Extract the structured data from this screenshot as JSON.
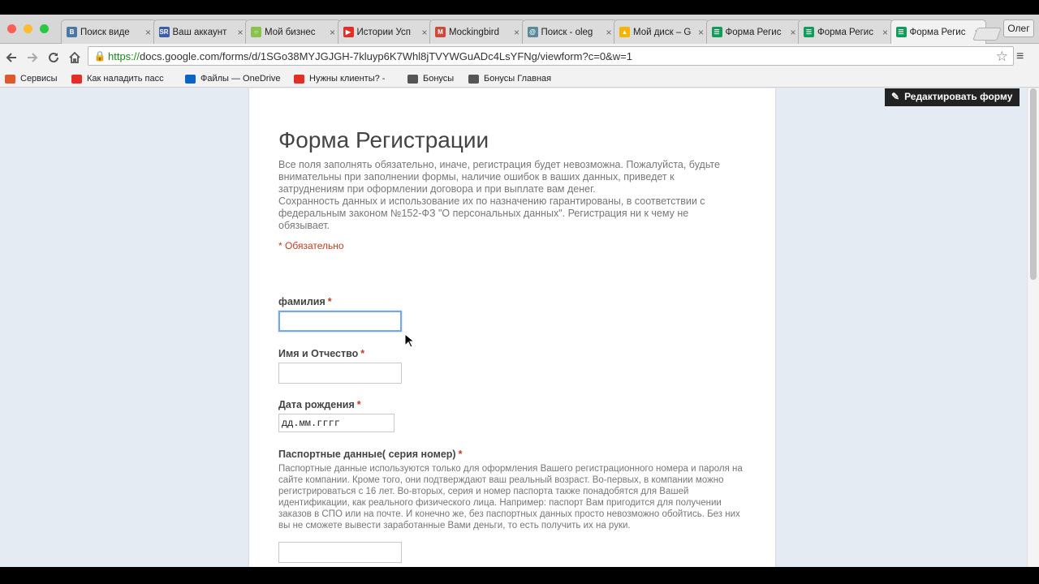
{
  "browser": {
    "tabs": [
      {
        "label": "Поиск виде",
        "icon": "vk-icon",
        "color": "#4a76a8",
        "glyph": "B"
      },
      {
        "label": "Ваш аккаунт",
        "icon": "sr-icon",
        "color": "#3b5ea8",
        "glyph": "SR"
      },
      {
        "label": "Мой бизнес",
        "icon": "circle-logo-icon",
        "color": "#8bc34a",
        "glyph": "○"
      },
      {
        "label": "Истории Усп",
        "icon": "youtube-icon",
        "color": "#e52d27",
        "glyph": "▶"
      },
      {
        "label": "Mockingbird",
        "icon": "gmail-icon",
        "color": "#d44638",
        "glyph": "M"
      },
      {
        "label": "Поиск - oleg",
        "icon": "search-site-icon",
        "color": "#5b8a9a",
        "glyph": "@"
      },
      {
        "label": "Мой диск – G",
        "icon": "google-drive-icon",
        "color": "#f4b400",
        "glyph": "▲"
      },
      {
        "label": "Форма Регис",
        "icon": "google-forms-icon",
        "color": "#0f9d58",
        "glyph": "☰"
      },
      {
        "label": "Форма Регис",
        "icon": "google-forms-icon",
        "color": "#0f9d58",
        "glyph": "☰"
      },
      {
        "label": "Форма Регис",
        "icon": "google-forms-icon",
        "color": "#0f9d58",
        "glyph": "☰"
      }
    ],
    "active_tab_index": 9,
    "profile_name": "Олег",
    "url_scheme": "https://",
    "url_rest": "docs.google.com/forms/d/1SGo38MYJGJGH-7kluyp6K7Whl8jTVYWGuADc4LsYFNg/viewform?c=0&w=1",
    "bookmarks": [
      {
        "label": "Сервисы",
        "icon": "apps-grid-icon",
        "color": "#e0592a"
      },
      {
        "label": "Как наладить пасс",
        "icon": "youtube-icon",
        "color": "#e52d27"
      },
      {
        "label": "Файлы — OneDrive",
        "icon": "onedrive-icon",
        "color": "#0a64c8"
      },
      {
        "label": "Нужны клиенты? -",
        "icon": "youtube-icon",
        "color": "#e52d27"
      },
      {
        "label": "Бонусы",
        "icon": "gc-logo-icon",
        "color": "#555555"
      },
      {
        "label": "Бонусы Главная",
        "icon": "gc-logo-icon",
        "color": "#555555"
      }
    ]
  },
  "edit_button_label": "Редактировать форму",
  "form": {
    "title": "Форма Регистрации",
    "description_1": "Все поля заполнять обязательно, иначе, регистрация будет невозможна. Пожалуйста, будьте внимательны при заполнении формы, наличие ошибок в ваших данных, приведет к затруднениям при оформлении договора и при выплате вам денег.",
    "description_2": "Сохранность данных и использование их по назначению гарантированы, в соответствии с федеральным законом №152-ФЗ \"О персональных данных\". Регистрация ни к чему не обязывает.",
    "required_note": "* Обязательно",
    "required_mark": "*",
    "questions": [
      {
        "label": "фамилия",
        "value": ""
      },
      {
        "label": "Имя и Отчество",
        "value": ""
      },
      {
        "label": "Дата рождения",
        "value": "дд.мм.гггг"
      },
      {
        "label": "Паспортные данные( серия номер)",
        "help": "Паспортные данные используются только для оформления Вашего регистрационного номера и пароля на сайте компании. Кроме того, они подтверждают ваш реальный возраст. Во-первых, в компании можно регистрироваться с 16 лет. Во-вторых, серия и номер паспорта также понадобятся для Вашей идентификации, как реального физического лица. Например: паспорт Вам пригодится для получении заказов в СПО или на почте. И конечно же, без паспортных данных просто невозможно обойтись. Без них вы не сможете вывести заработанные Вами деньги, то есть получить их на руки.",
        "value": ""
      }
    ]
  }
}
